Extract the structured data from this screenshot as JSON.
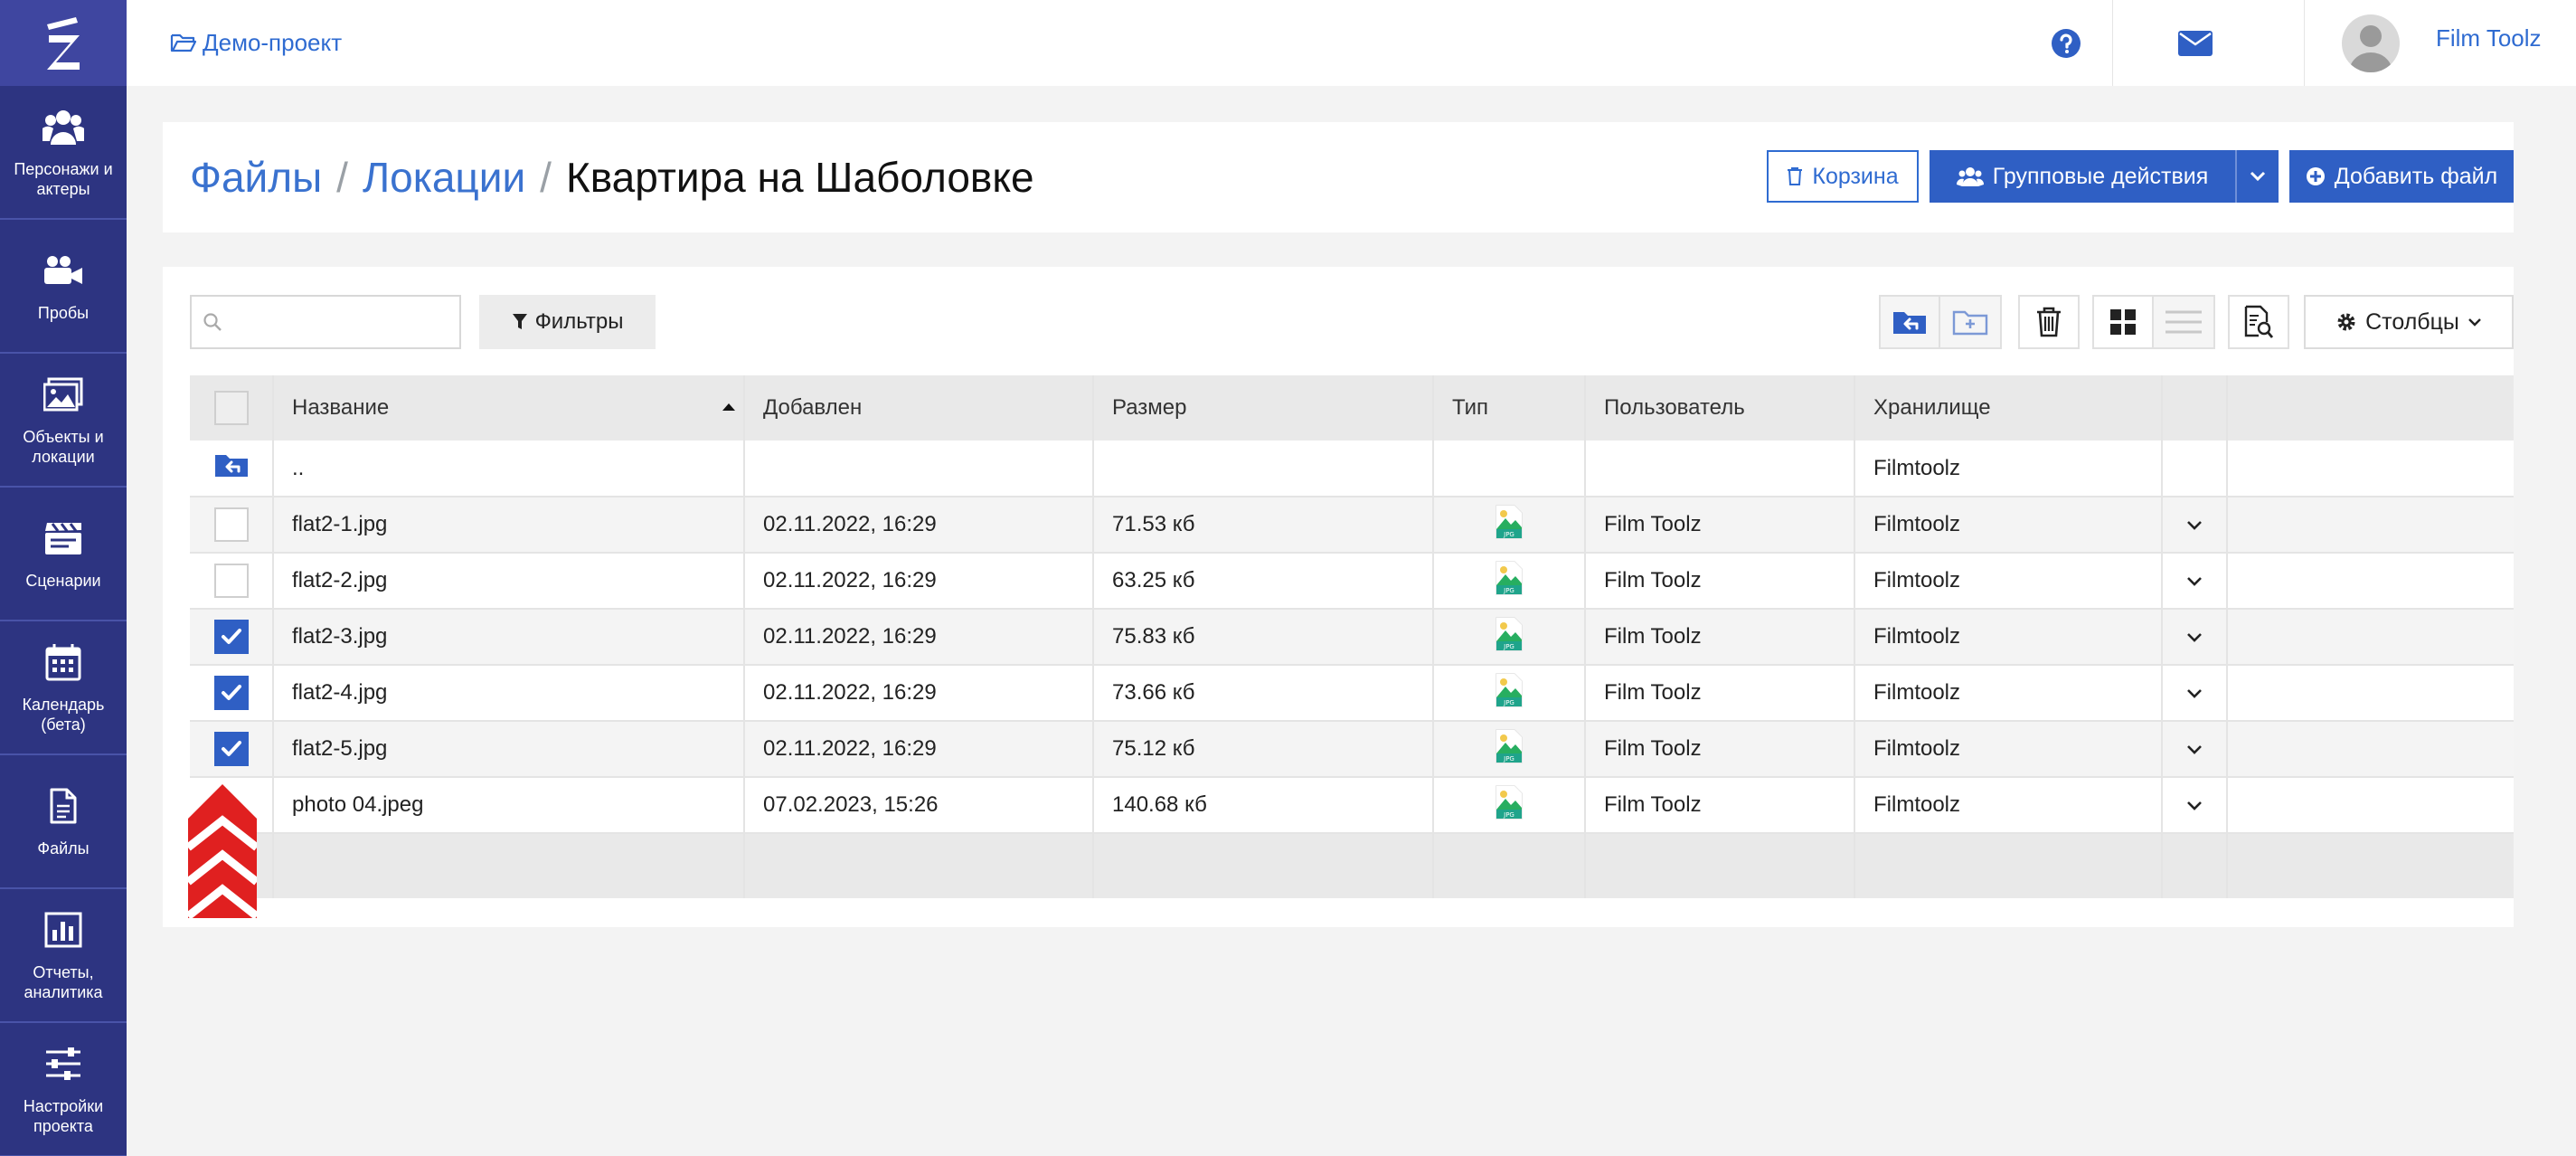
{
  "sidebar": {
    "logo": "Z",
    "items": [
      {
        "label": "Персонажи и\nактеры",
        "icon": "users-icon"
      },
      {
        "label": "Пробы",
        "icon": "video-camera-icon"
      },
      {
        "label": "Объекты и\nлокации",
        "icon": "image-icon"
      },
      {
        "label": "Сценарии",
        "icon": "clapperboard-icon"
      },
      {
        "label": "Календарь\n(бета)",
        "icon": "calendar-icon"
      },
      {
        "label": "Файлы",
        "icon": "file-icon"
      },
      {
        "label": "Отчеты,\nаналитика",
        "icon": "bar-chart-icon"
      },
      {
        "label": "Настройки\nпроекта",
        "icon": "sliders-icon"
      }
    ]
  },
  "topbar": {
    "project": "Демо-проект",
    "user_name": "Film Toolz"
  },
  "header": {
    "breadcrumb": [
      "Файлы",
      "Локации",
      "Квартира на Шаболовке"
    ],
    "trash_label": "Корзина",
    "group_actions_label": "Групповые действия",
    "add_file_label": "Добавить файл"
  },
  "toolbar": {
    "search_placeholder": "",
    "filters_label": "Фильтры",
    "columns_label": "Столбцы"
  },
  "table": {
    "headers": [
      "Название",
      "Добавлен",
      "Размер",
      "Тип",
      "Пользователь",
      "Хранилище"
    ],
    "up_row": {
      "name": "..",
      "storage": "Filmtoolz"
    },
    "rows": [
      {
        "name": "flat2-1.jpg",
        "added": "02.11.2022, 16:29",
        "size": "71.53 кб",
        "type": "JPG",
        "user": "Film Toolz",
        "storage": "Filmtoolz",
        "checked": false
      },
      {
        "name": "flat2-2.jpg",
        "added": "02.11.2022, 16:29",
        "size": "63.25 кб",
        "type": "JPG",
        "user": "Film Toolz",
        "storage": "Filmtoolz",
        "checked": false
      },
      {
        "name": "flat2-3.jpg",
        "added": "02.11.2022, 16:29",
        "size": "75.83 кб",
        "type": "JPG",
        "user": "Film Toolz",
        "storage": "Filmtoolz",
        "checked": true
      },
      {
        "name": "flat2-4.jpg",
        "added": "02.11.2022, 16:29",
        "size": "73.66 кб",
        "type": "JPG",
        "user": "Film Toolz",
        "storage": "Filmtoolz",
        "checked": true
      },
      {
        "name": "flat2-5.jpg",
        "added": "02.11.2022, 16:29",
        "size": "75.12 кб",
        "type": "JPG",
        "user": "Film Toolz",
        "storage": "Filmtoolz",
        "checked": true
      },
      {
        "name": "photo 04.jpeg",
        "added": "07.02.2023, 15:26",
        "size": "140.68 кб",
        "type": "JPG",
        "user": "Film Toolz",
        "storage": "Filmtoolz",
        "checked": false
      }
    ]
  },
  "colors": {
    "sidebar": "#2d3481",
    "accent": "#2f5fc4",
    "link": "#2f6bd1",
    "arrow": "#e02020"
  }
}
